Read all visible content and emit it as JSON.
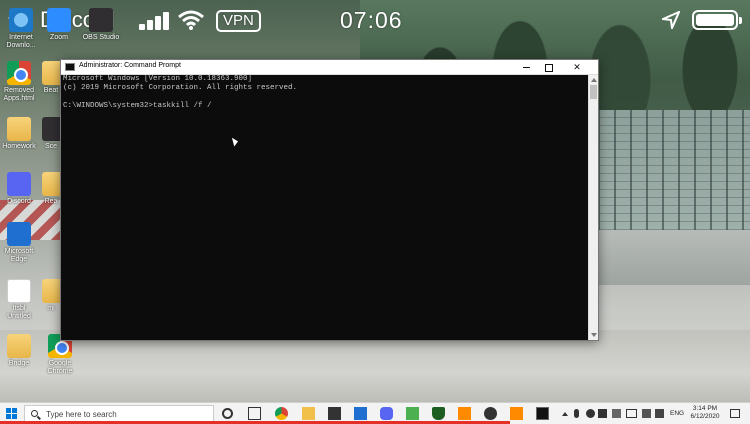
{
  "ios_status": {
    "back_app": "Discord",
    "vpn": "VPN",
    "time": "07:06"
  },
  "desktop_icons": [
    {
      "label": "Internet Downlo...",
      "icon": "ie-icon"
    },
    {
      "label": "Zoom",
      "icon": "zoom-icon"
    },
    {
      "label": "OBS Studio",
      "icon": "obs-icon"
    },
    {
      "label": "Removed Apps.html",
      "icon": "chrome-icon"
    },
    {
      "label": "Beat",
      "icon": "folder-icon"
    },
    {
      "label": "Homework",
      "icon": "folder-icon"
    },
    {
      "label": "Sce",
      "icon": "steam-icon"
    },
    {
      "label": "Discord",
      "icon": "discord-icon"
    },
    {
      "label": "Rea",
      "icon": "folder-icon"
    },
    {
      "label": "Microsoft Edge",
      "icon": "edge-icon"
    },
    {
      "label": "Itsbl Untitled",
      "icon": "doc-icon"
    },
    {
      "label": "mi",
      "icon": "folder-icon"
    },
    {
      "label": "Bridge",
      "icon": "folder-icon"
    },
    {
      "label": "Google Chrome",
      "icon": "chrome-icon"
    }
  ],
  "cmd": {
    "title": "Administrator: Command Prompt",
    "lines": [
      "Microsoft Windows [Version 10.0.18363.900]",
      "(c) 2019 Microsoft Corporation. All rights reserved.",
      "",
      "C:\\WINDOWS\\system32>taskkill /f /"
    ]
  },
  "taskbar": {
    "search_placeholder": "Type here to search",
    "language": "ENG",
    "time": "3:14 PM",
    "date": "6/12/2020"
  },
  "colors": {
    "accent": "#0078d7",
    "recording_bar": "#e5302a"
  }
}
